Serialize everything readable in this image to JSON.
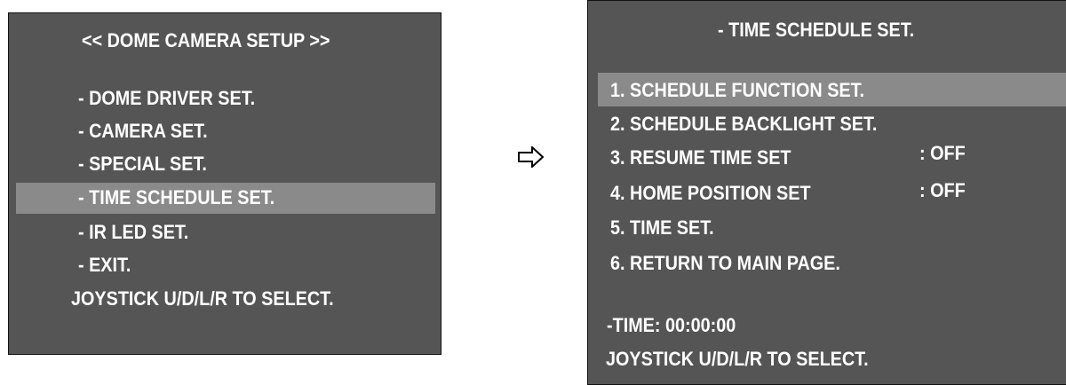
{
  "colors": {
    "panel_background": "#555555",
    "highlight": "#8a8a8a",
    "text": "#ffffff"
  },
  "main_menu": {
    "title": "<< DOME CAMERA SETUP >>",
    "items": [
      {
        "label": "- DOME DRIVER SET.",
        "selected": false
      },
      {
        "label": "- CAMERA SET.",
        "selected": false
      },
      {
        "label": "- SPECIAL SET.",
        "selected": false
      },
      {
        "label": "- TIME SCHEDULE SET.",
        "selected": true
      },
      {
        "label": "- IR LED SET.",
        "selected": false
      },
      {
        "label": "- EXIT.",
        "selected": false
      }
    ],
    "hint": "JOYSTICK U/D/L/R TO SELECT."
  },
  "transition_icon": "right-arrow-icon",
  "schedule_menu": {
    "title": "- TIME SCHEDULE SET.",
    "items": [
      {
        "label": "1. SCHEDULE FUNCTION SET.",
        "value": "",
        "selected": true
      },
      {
        "label": "2. SCHEDULE BACKLIGHT SET.",
        "value": "",
        "selected": false
      },
      {
        "label": "3. RESUME TIME SET",
        "value": ": OFF",
        "selected": false
      },
      {
        "label": "4. HOME POSITION SET",
        "value": ": OFF",
        "selected": false
      },
      {
        "label": "5. TIME SET.",
        "value": "",
        "selected": false
      },
      {
        "label": "6. RETURN TO MAIN PAGE.",
        "value": "",
        "selected": false
      }
    ],
    "time_readout": "-TIME: 00:00:00",
    "hint": "JOYSTICK U/D/L/R TO SELECT."
  }
}
